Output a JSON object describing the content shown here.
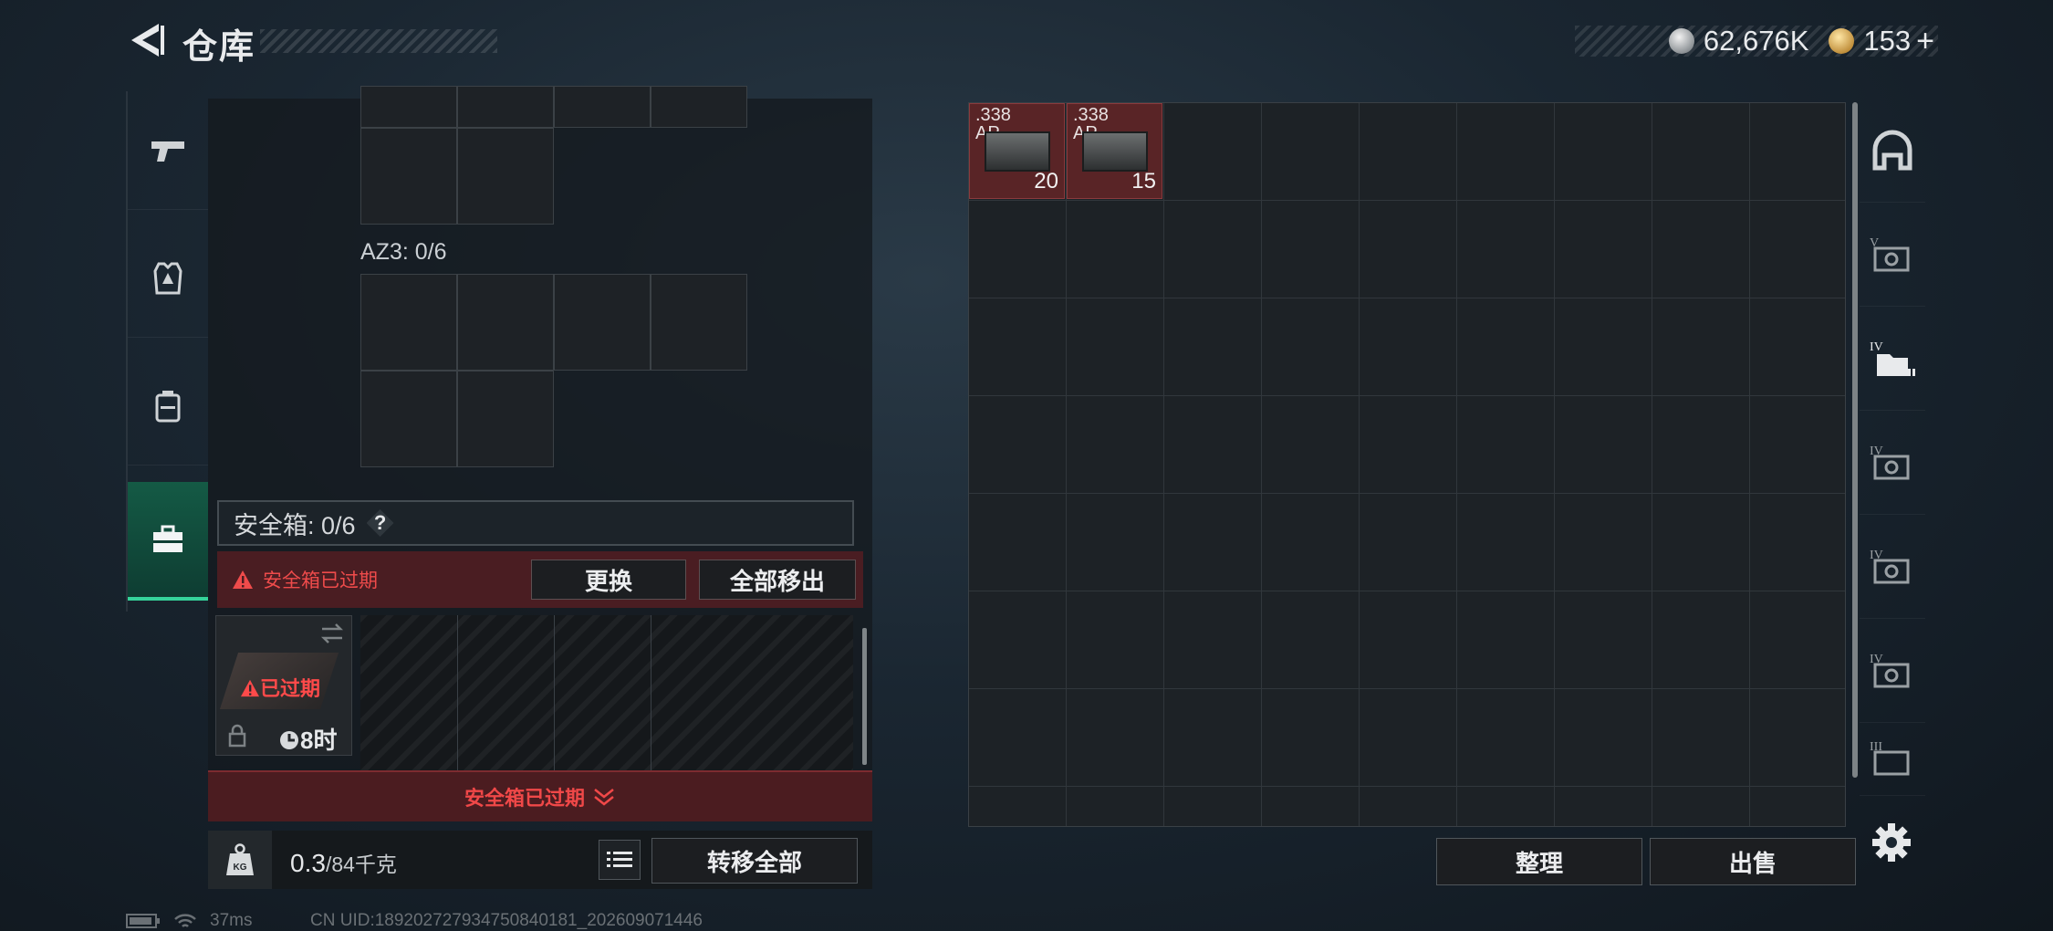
{
  "header": {
    "title": "仓库",
    "currency_silver": "62,676K",
    "currency_gold": "153",
    "plus_label": "+"
  },
  "left": {
    "az3_label": "AZ3: 0/6",
    "safe_label": "安全箱: 0/6",
    "help_label": "?",
    "expired_text": "安全箱已过期",
    "replace_label": "更换",
    "remove_all_label": "全部移出",
    "case_expired": "已过期",
    "case_time": "8时",
    "bottom_expired": "安全箱已过期",
    "weight_value": "0.3",
    "weight_unit": "/84千克",
    "weight_icon_label": "KG",
    "transfer_all_label": "转移全部"
  },
  "stash": {
    "items": [
      {
        "caliber": ".338",
        "type": "AP",
        "count": "20"
      },
      {
        "caliber": ".338",
        "type": "AP",
        "count": "15"
      }
    ],
    "sort_label": "整理",
    "sell_label": "出售"
  },
  "side_tabs": [
    {
      "icon": "helmet-icon",
      "tier": ""
    },
    {
      "icon": "safe-box-icon",
      "tier": "V"
    },
    {
      "icon": "folder-icon",
      "tier": "IV"
    },
    {
      "icon": "safe-box-icon",
      "tier": "IV"
    },
    {
      "icon": "safe-box-icon",
      "tier": "IV"
    },
    {
      "icon": "safe-box-icon",
      "tier": "IV"
    },
    {
      "icon": "safe-box-icon",
      "tier": "III"
    }
  ],
  "status": {
    "ping": "37ms",
    "uid": "CN UID:18920272793475084018​1_202609071446"
  },
  "colors": {
    "accent_green": "#35d39a",
    "alert_red": "#ef4b4b",
    "item_red": "#592426"
  }
}
